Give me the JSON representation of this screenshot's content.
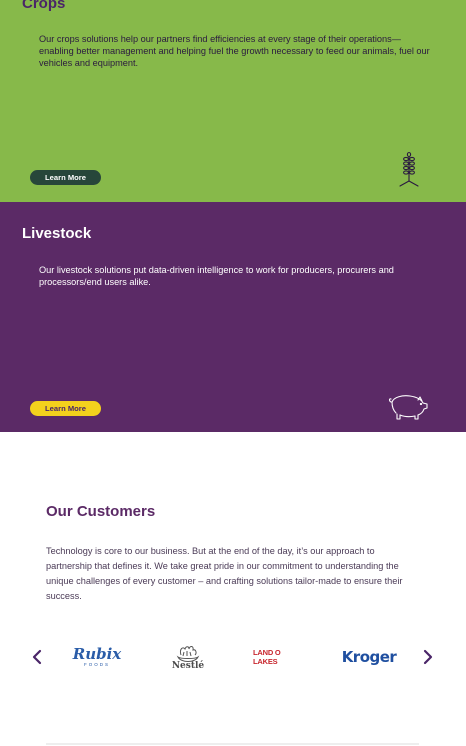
{
  "crops": {
    "title": "Crops",
    "description": "Our crops solutions help our partners find efficiencies at every stage of their operations—enabling better management and helping fuel the growth necessary to feed our animals, fuel our vehicles and equipment.",
    "button_label": "Learn More",
    "icon": "wheat-icon",
    "bg_color": "#87b94a",
    "button_color": "#27463a"
  },
  "livestock": {
    "title": "Livestock",
    "description": "Our livestock solutions put data-driven intelligence to work for producers, procurers and processors/end users alike.",
    "button_label": "Learn More",
    "icon": "pig-icon",
    "bg_color": "#5b2a66",
    "button_color": "#f3d11d"
  },
  "customers": {
    "title": "Our Customers",
    "description": "Technology is core to our business. But at the end of the day, it’s our approach to partnership that defines it. We take great pride in our commitment to understanding the unique challenges of every customer – and crafting solutions tailor-made to ensure their success.",
    "logos": [
      {
        "name": "Rubix",
        "word": "Rubix",
        "sub": "FOODS"
      },
      {
        "name": "Nestlé",
        "word": "Nestlé"
      },
      {
        "name": "Land O Lakes",
        "word": "LAND O LAKES"
      },
      {
        "name": "Kroger",
        "word": "Kroger"
      }
    ],
    "prev_icon": "chevron-left-icon",
    "next_icon": "chevron-right-icon"
  }
}
